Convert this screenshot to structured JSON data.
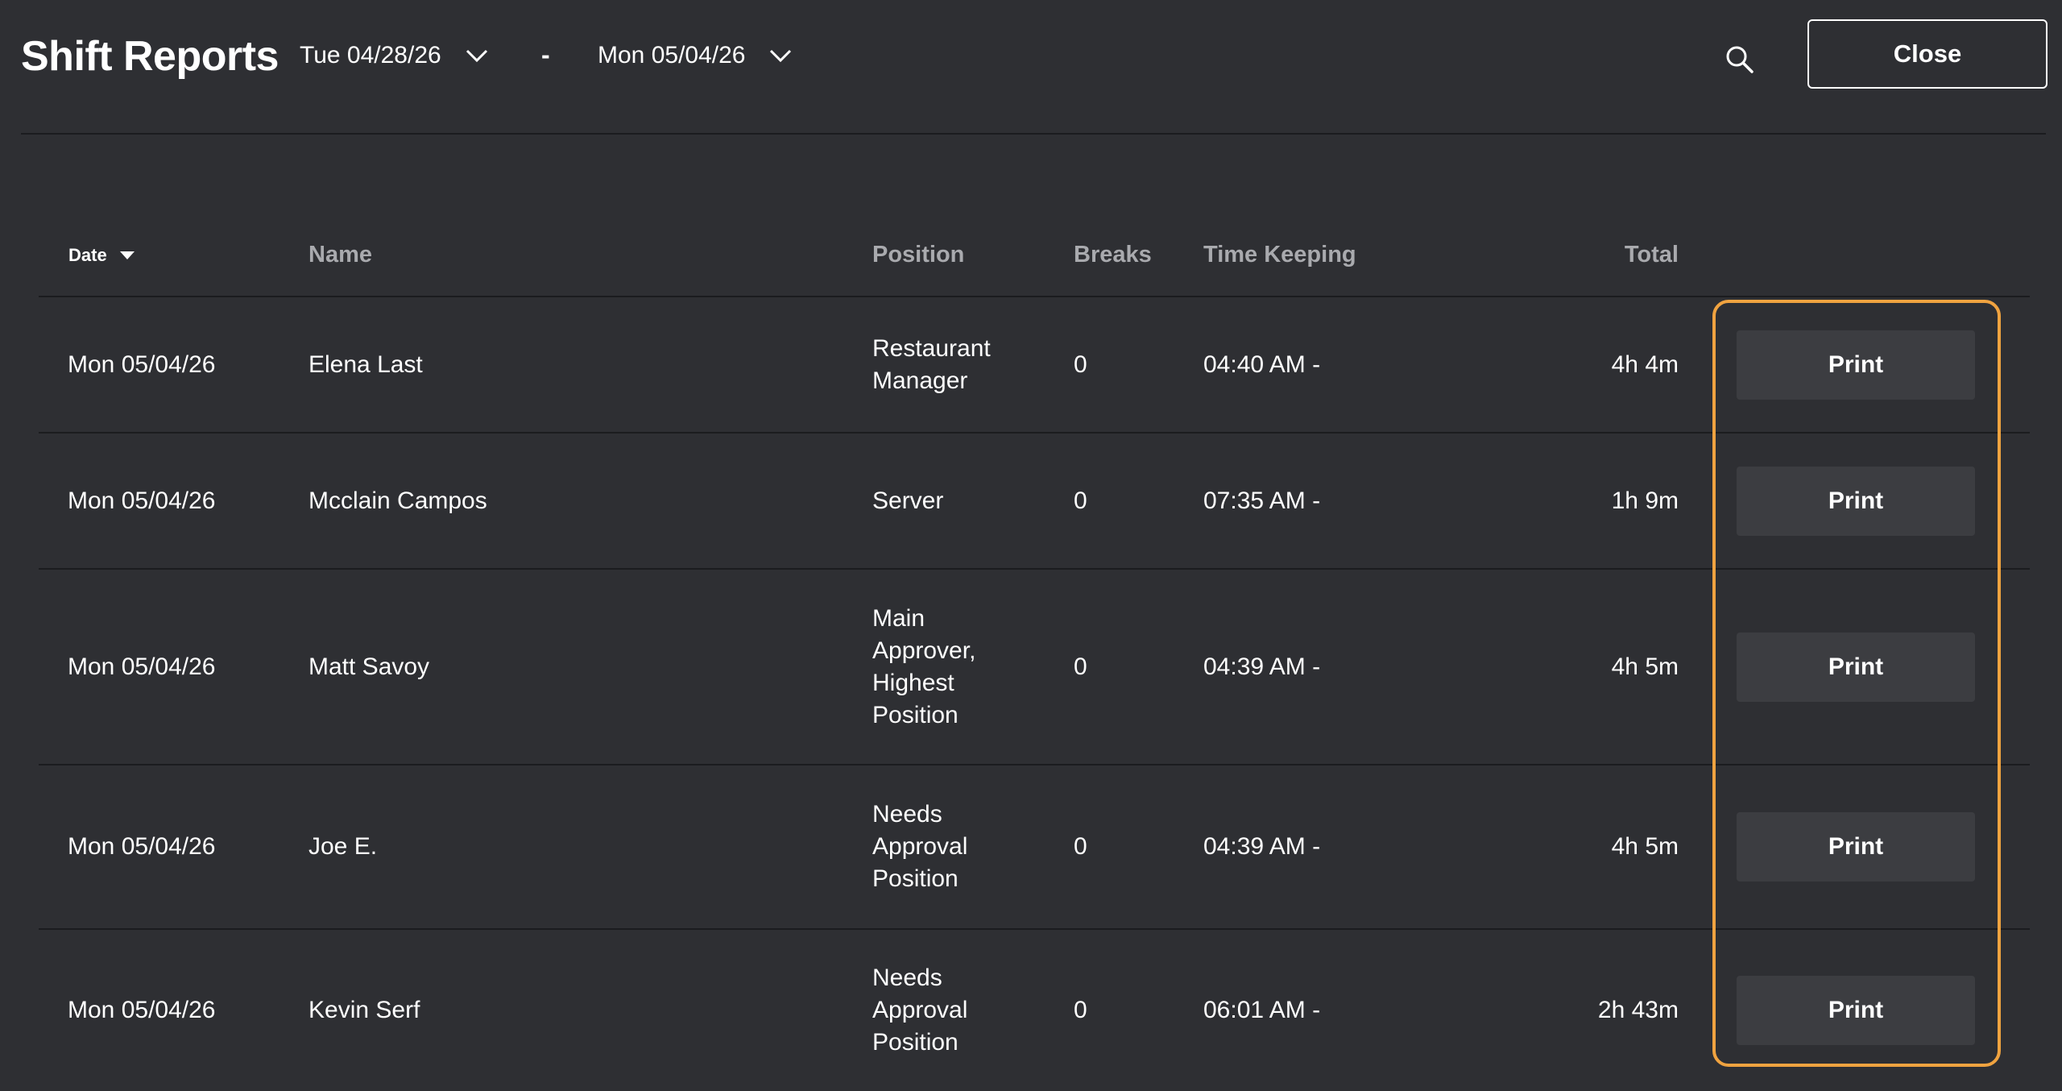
{
  "header": {
    "title": "Shift Reports",
    "start_date": "Tue 04/28/26",
    "separator": "-",
    "end_date": "Mon 05/04/26",
    "close_label": "Close"
  },
  "table": {
    "columns": {
      "date": "Date",
      "name": "Name",
      "position": "Position",
      "breaks": "Breaks",
      "time_keeping": "Time Keeping",
      "total": "Total"
    },
    "rows": [
      {
        "date": "Mon 05/04/26",
        "name": "Elena Last",
        "position": "Restaurant Manager",
        "breaks": "0",
        "time": "04:40 AM -",
        "total": "4h 4m",
        "action": "Print"
      },
      {
        "date": "Mon 05/04/26",
        "name": "Mcclain Campos",
        "position": "Server",
        "breaks": "0",
        "time": "07:35 AM -",
        "total": "1h 9m",
        "action": "Print"
      },
      {
        "date": "Mon 05/04/26",
        "name": "Matt Savoy",
        "position": "Main Approver, Highest Position",
        "breaks": "0",
        "time": "04:39 AM -",
        "total": "4h 5m",
        "action": "Print"
      },
      {
        "date": "Mon 05/04/26",
        "name": "Joe E.",
        "position": "Needs Approval Position",
        "breaks": "0",
        "time": "04:39 AM -",
        "total": "4h 5m",
        "action": "Print"
      },
      {
        "date": "Mon 05/04/26",
        "name": "Kevin Serf",
        "position": "Needs Approval Position",
        "breaks": "0",
        "time": "06:01 AM -",
        "total": "2h 43m",
        "action": "Print"
      }
    ]
  },
  "colors": {
    "background": "#2e2f33",
    "button": "#3c3d41",
    "highlight": "#f0a340",
    "header_text": "#a9aaae"
  }
}
